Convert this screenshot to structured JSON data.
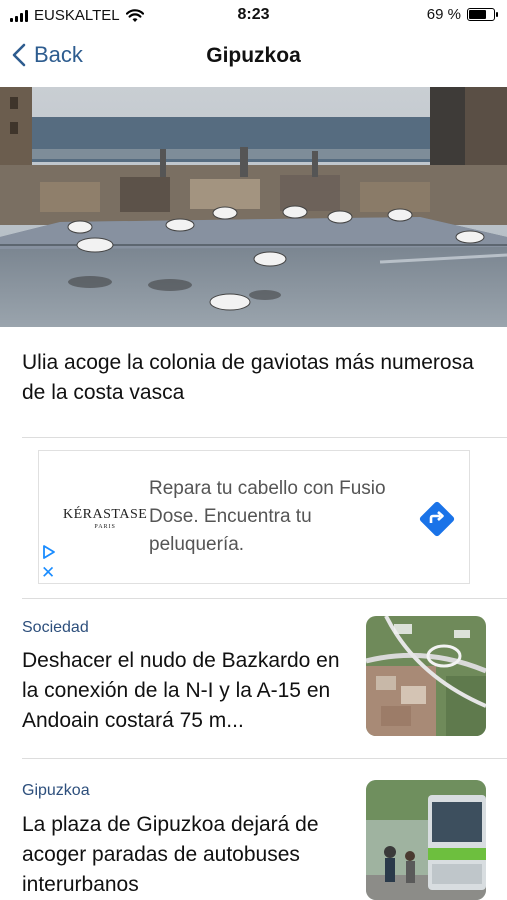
{
  "status_bar": {
    "carrier": "EUSKALTEL",
    "time": "8:23",
    "battery_text": "69 %",
    "battery_level": 0.69
  },
  "nav": {
    "back_label": "Back",
    "title": "Gipuzkoa"
  },
  "hero": {
    "caption": "Ulia acoge la colonia de gaviotas más numerosa de la costa vasca"
  },
  "ad": {
    "brand": "KÉRASTASE",
    "brand_sub": "PARIS",
    "text": "Repara tu cabello con Fusio Dose. Encuentra tu peluquería.",
    "close": "✕"
  },
  "articles": [
    {
      "category": "Sociedad",
      "title": "Deshacer el nudo de Bazkardo en la conexión de la N-I y la A-15 en Andoain costará 75 m..."
    },
    {
      "category": "Gipuzkoa",
      "title": "La plaza de Gipuzkoa dejará de acoger paradas de autobuses interurbanos"
    }
  ],
  "colors": {
    "accent": "#2d5c8f",
    "category": "#2d4f7c",
    "ad_arrow": "#1a73e8"
  }
}
